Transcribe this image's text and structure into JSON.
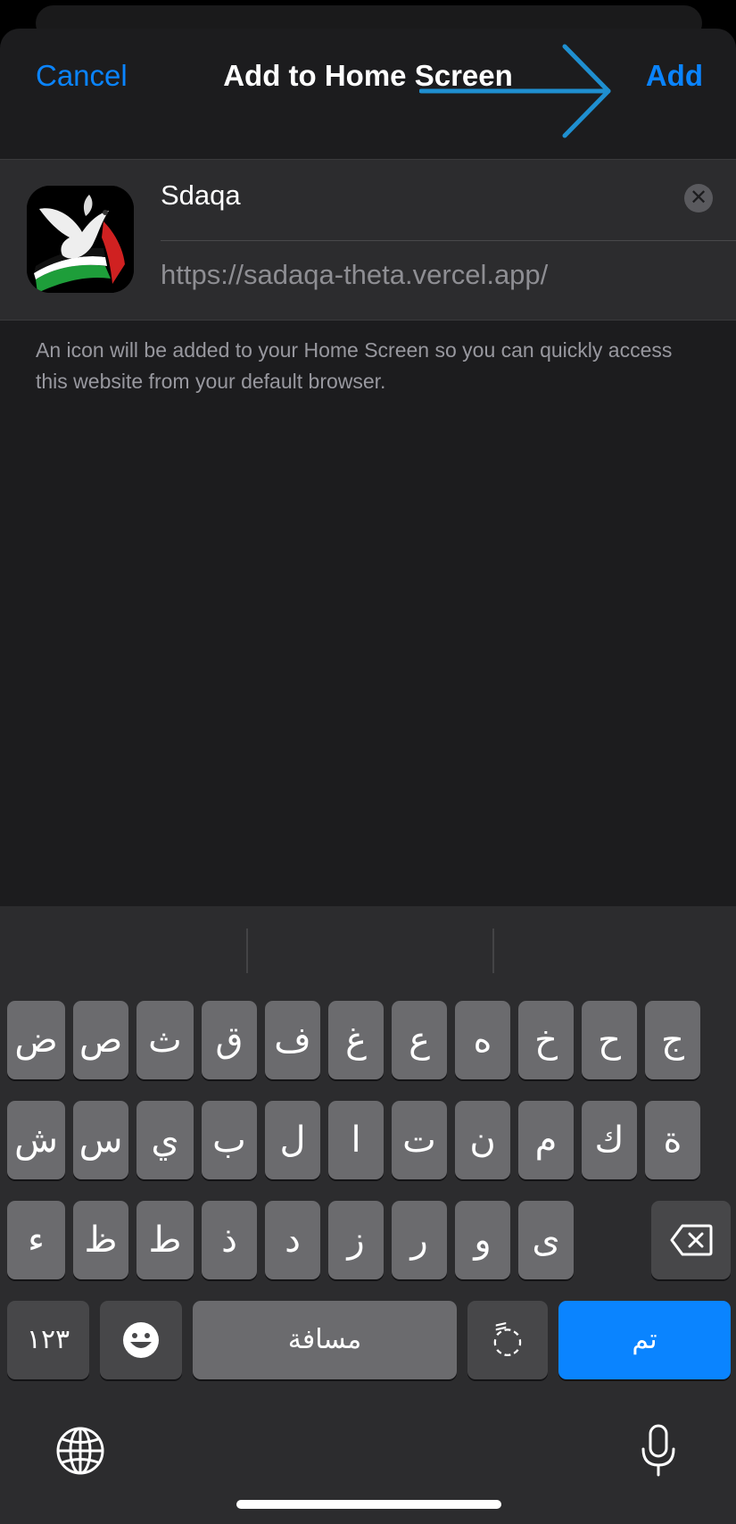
{
  "nav": {
    "cancel_label": "Cancel",
    "title": "Add to Home Screen",
    "add_label": "Add"
  },
  "app": {
    "name": "Sdaqa",
    "url": "https://sadaqa-theta.vercel.app/"
  },
  "footnote": "An icon will be added to your Home Screen so you can quickly access this website from your default browser.",
  "colors": {
    "accent": "#0a84ff",
    "sheet_bg": "#1c1c1e",
    "card_bg": "#2c2c2e",
    "key": "#6b6b6e",
    "key_dark": "#474749",
    "annotation_arrow": "#1f8fd0"
  },
  "keyboard": {
    "row1": [
      "ض",
      "ص",
      "ث",
      "ق",
      "ف",
      "غ",
      "ع",
      "ه",
      "خ",
      "ح",
      "ج"
    ],
    "row2": [
      "ش",
      "س",
      "ي",
      "ب",
      "ل",
      "ا",
      "ت",
      "ن",
      "م",
      "ك",
      "ة"
    ],
    "row3": [
      "ء",
      "ظ",
      "ط",
      "ذ",
      "د",
      "ز",
      "ر",
      "و",
      "ى"
    ],
    "numbers_label": "١٢٣",
    "space_label": "مسافة",
    "diacritic_label": "◌ً",
    "done_label": "تم",
    "icons": [
      "delete-key-icon",
      "emoji-icon",
      "globe-icon",
      "microphone-icon"
    ]
  }
}
